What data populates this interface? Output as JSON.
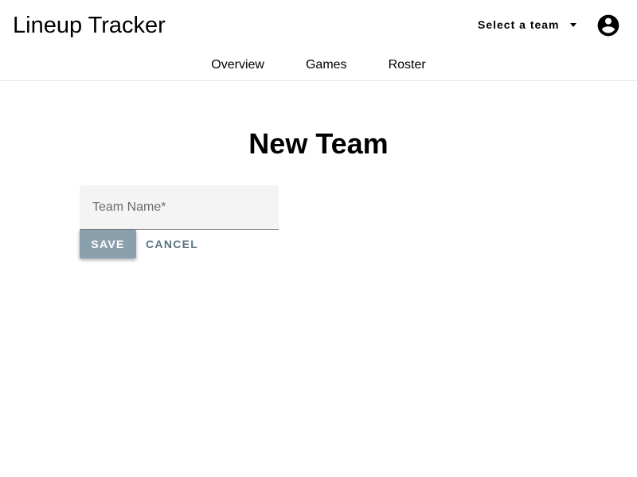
{
  "header": {
    "app_title": "Lineup Tracker",
    "team_select_label": "Select a team",
    "nav_tabs": [
      {
        "label": "Overview"
      },
      {
        "label": "Games"
      },
      {
        "label": "Roster"
      }
    ]
  },
  "main": {
    "page_title": "New Team",
    "team_name_field": {
      "value": "",
      "placeholder": "Team Name*"
    },
    "save_label": "SAVE",
    "cancel_label": "CANCEL"
  },
  "colors": {
    "save_button_bg": "#8aa0ad",
    "cancel_text": "#5d7480",
    "field_bg": "#f4f4f4"
  },
  "icons": {
    "team_select": "caret-down-icon",
    "account": "account-circle-icon"
  }
}
